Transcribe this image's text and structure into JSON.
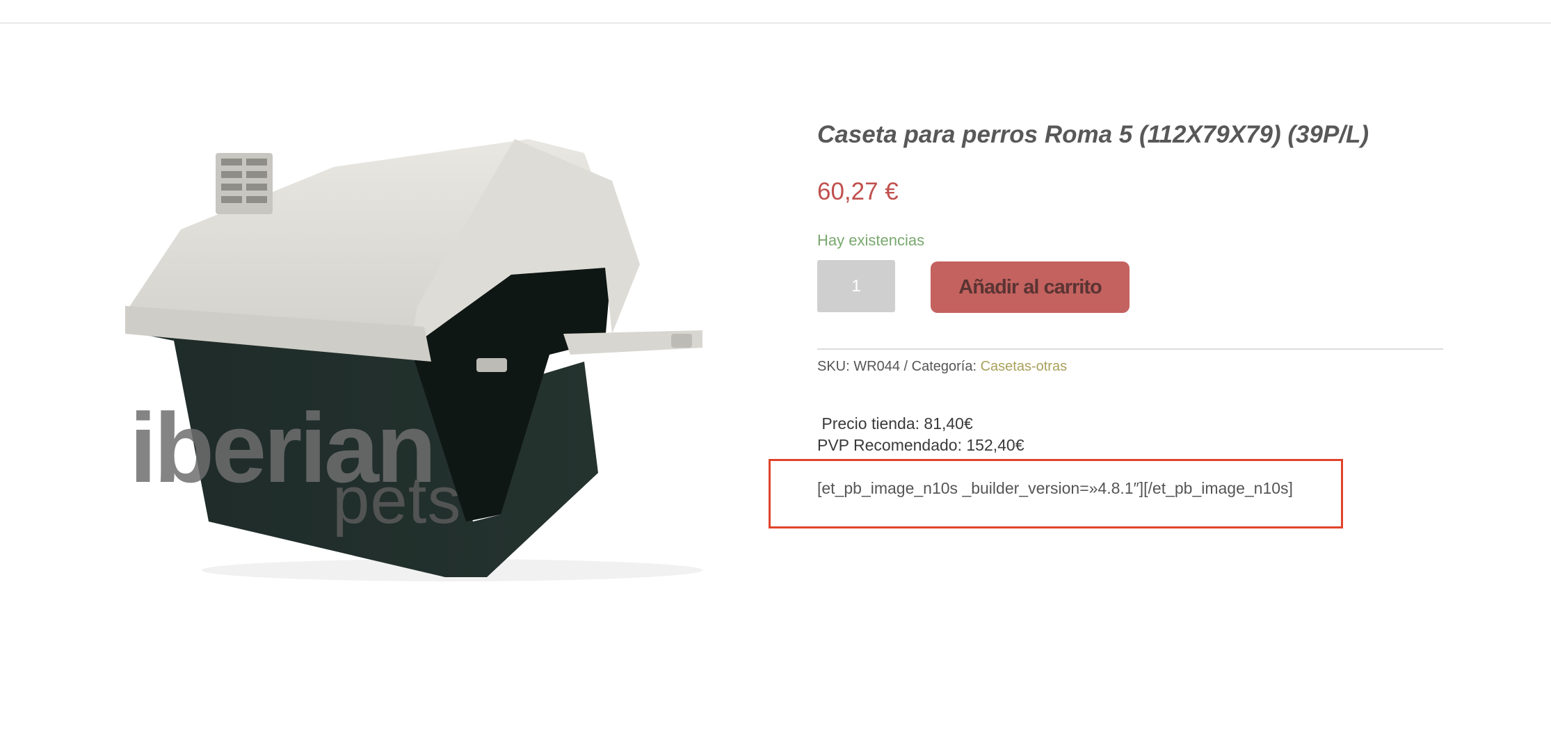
{
  "product": {
    "title": "Caseta para perros Roma 5 (112X79X79) (39P/L)",
    "price": "60,27 €",
    "stock_status": "Hay existencias",
    "quantity": "1",
    "add_to_cart_label": "Añadir al carrito",
    "sku_label": "SKU:",
    "sku_value": "WR044",
    "separator": "/",
    "category_label": "Categoría:",
    "category_value": "Casetas-otras",
    "store_price": " Precio tienda: 81,40€",
    "rrp_price": "PVP Recomendado: 152,40€",
    "shortcode_text": "[et_pb_image_n10s _builder_version=»4.8.1″][/et_pb_image_n10s]"
  },
  "image": {
    "watermark_title": "iberian",
    "watermark_subtitle": "pets"
  },
  "colors": {
    "price": "#c0504d",
    "stock": "#79a86d",
    "button": "#c4625f",
    "category_link": "#a8a05a",
    "highlight_border": "#e0442b"
  }
}
